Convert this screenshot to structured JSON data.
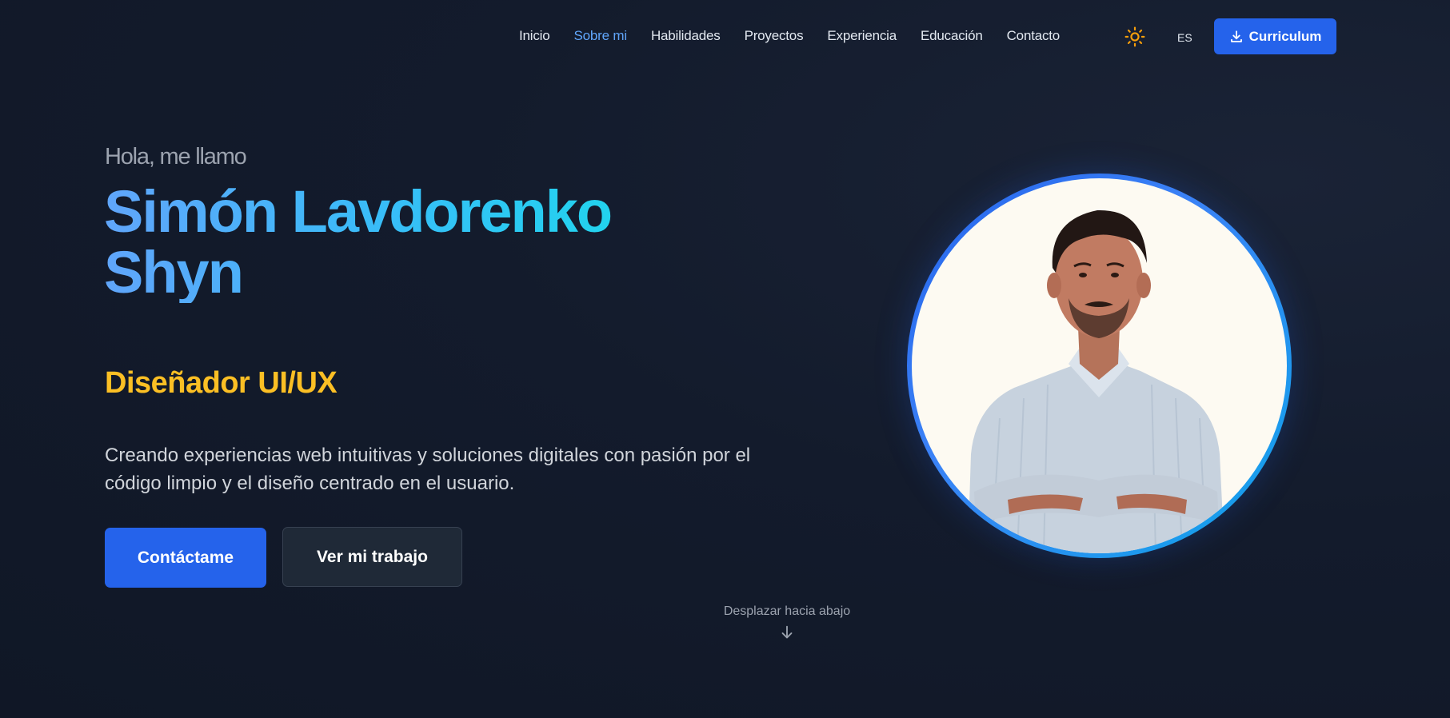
{
  "nav": {
    "links": [
      {
        "label": "Inicio"
      },
      {
        "label": "Sobre mi"
      },
      {
        "label": "Habilidades"
      },
      {
        "label": "Proyectos"
      },
      {
        "label": "Experiencia"
      },
      {
        "label": "Educación"
      },
      {
        "label": "Contacto"
      }
    ],
    "active_link": "Sobre mi",
    "language": "ES",
    "cv_button": "Curriculum",
    "theme_icon": "sun-icon"
  },
  "hero": {
    "greeting": "Hola, me llamo",
    "name_line1": "Simón Lavdorenko",
    "name_line2": "Shyn",
    "role": "Diseñador UI/UX",
    "description": "Creando experiencias web intuitivas y soluciones digitales con pasión por el código limpio y el diseño centrado en el usuario.",
    "primary_button": "Contáctame",
    "secondary_button": "Ver mi trabajo",
    "scroll_hint": "Desplazar hacia abajo"
  },
  "colors": {
    "background": "#131b2c",
    "accent_blue": "#2563eb",
    "active_link": "#60a5fa",
    "role_yellow": "#fbbf24",
    "name_gradient_start": "#60a5fa",
    "name_gradient_end": "#22d3ee"
  }
}
